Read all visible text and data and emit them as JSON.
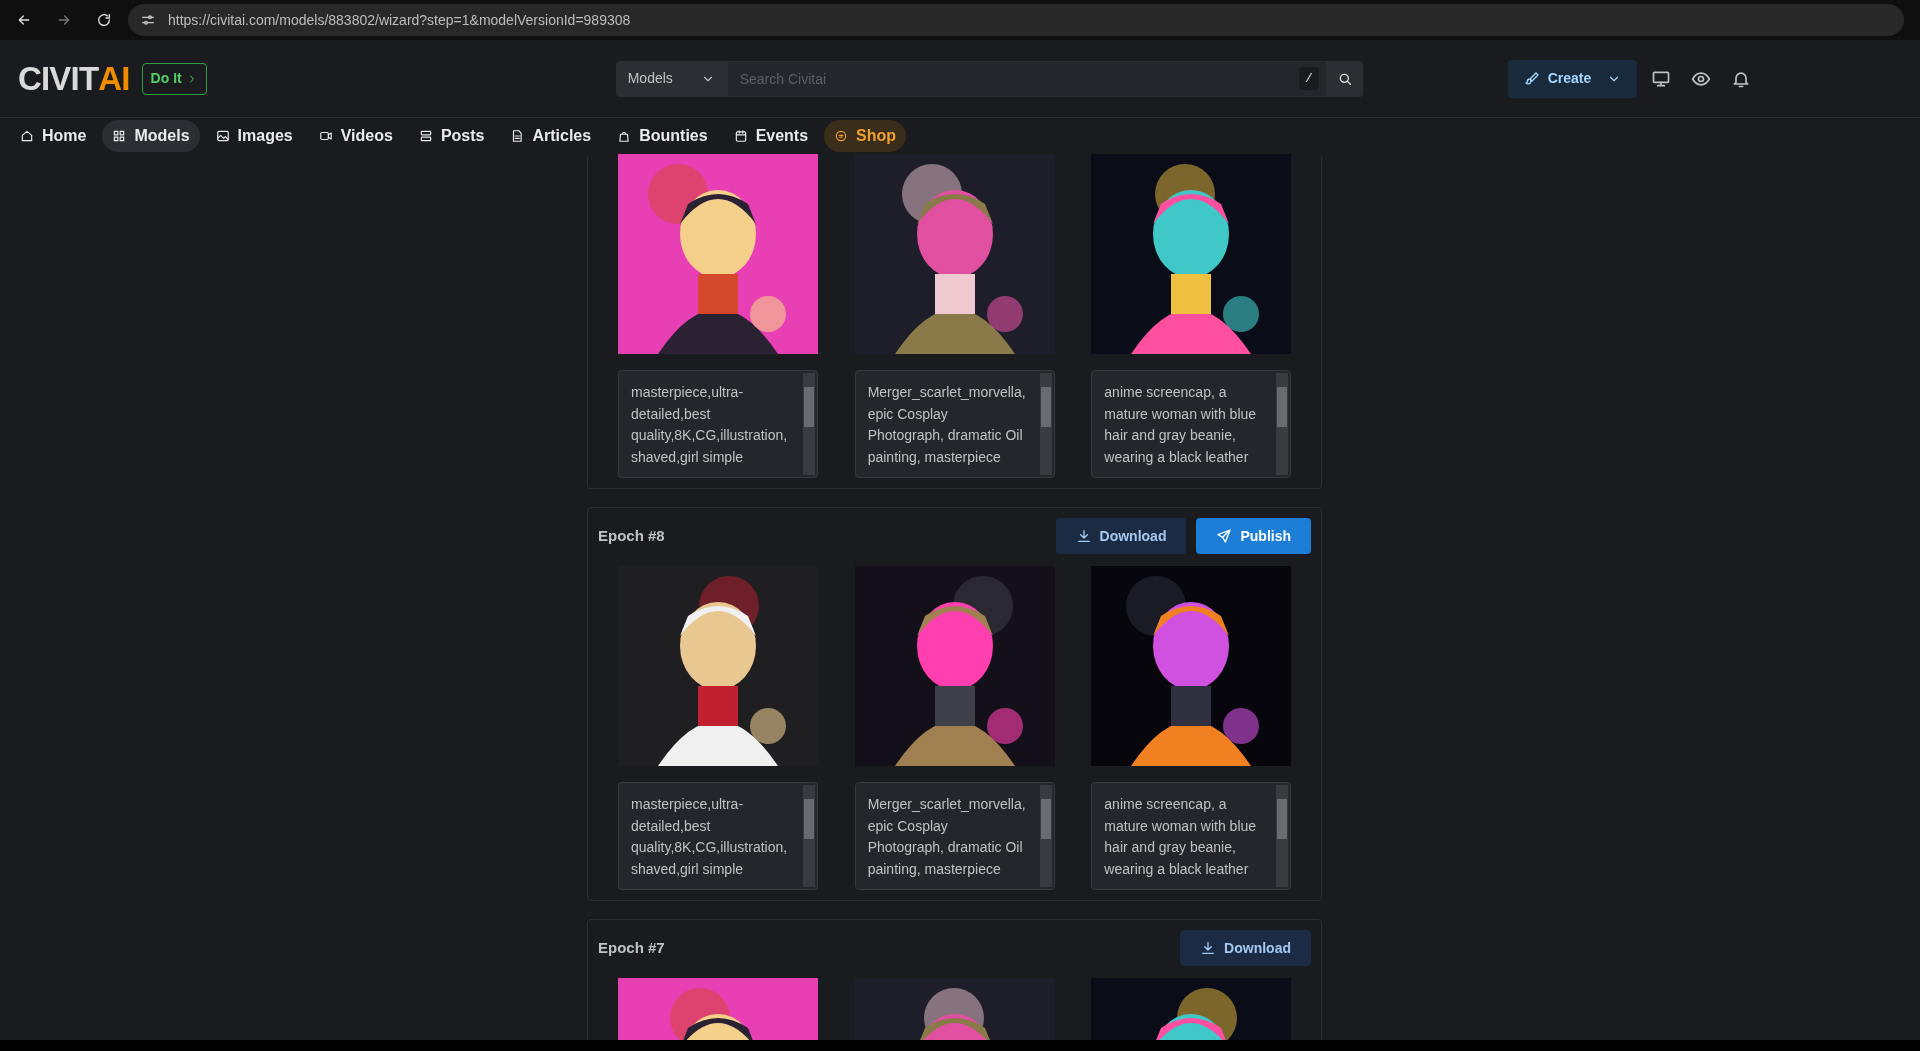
{
  "browser": {
    "url": "https://civitai.com/models/883802/wizard?step=1&modelVersionId=989308"
  },
  "header": {
    "logo": {
      "main": "CIVIT",
      "accent": "AI"
    },
    "promo_button": "Do It",
    "search": {
      "scope": "Models",
      "placeholder": "Search Civitai",
      "shortcut": "/"
    },
    "create_button": "Create"
  },
  "nav": [
    {
      "label": "Home",
      "selected": false
    },
    {
      "label": "Models",
      "selected": true
    },
    {
      "label": "Images",
      "selected": false
    },
    {
      "label": "Videos",
      "selected": false
    },
    {
      "label": "Posts",
      "selected": false
    },
    {
      "label": "Articles",
      "selected": false
    },
    {
      "label": "Bounties",
      "selected": false
    },
    {
      "label": "Events",
      "selected": false
    },
    {
      "label": "Shop",
      "selected": false,
      "kind": "shop"
    }
  ],
  "epochs": [
    {
      "samples": [
        {
          "kind": "picture",
          "prompt": "masterpiece,ultra-detailed,best quality,8K,CG,illustration, shaved,girl simple"
        },
        {
          "kind": "picture",
          "prompt": "Merger_scarlet_morvella, epic Cosplay Photograph, dramatic Oil painting, masterpiece"
        },
        {
          "kind": "picture",
          "prompt": "anime screencap, a mature woman with blue hair and gray beanie, wearing a black leather"
        }
      ]
    },
    {
      "title": "Epoch #8",
      "buttons": [
        {
          "label": "Download",
          "kind": "download"
        },
        {
          "label": "Publish",
          "kind": "publish"
        }
      ],
      "samples": [
        {
          "kind": "picture",
          "prompt": "masterpiece,ultra-detailed,best quality,8K,CG,illustration, shaved,girl simple"
        },
        {
          "kind": "picture",
          "prompt": "Merger_scarlet_morvella, epic Cosplay Photograph, dramatic Oil painting, masterpiece"
        },
        {
          "kind": "picture",
          "prompt": "anime screencap, a mature woman with blue hair and gray beanie, wearing a black leather"
        }
      ]
    },
    {
      "title": "Epoch #7",
      "buttons": [
        {
          "label": "Download",
          "kind": "download"
        }
      ],
      "samples": [
        {
          "kind": "picture"
        },
        {
          "kind": "picture"
        },
        {
          "kind": "picture"
        }
      ]
    }
  ]
}
